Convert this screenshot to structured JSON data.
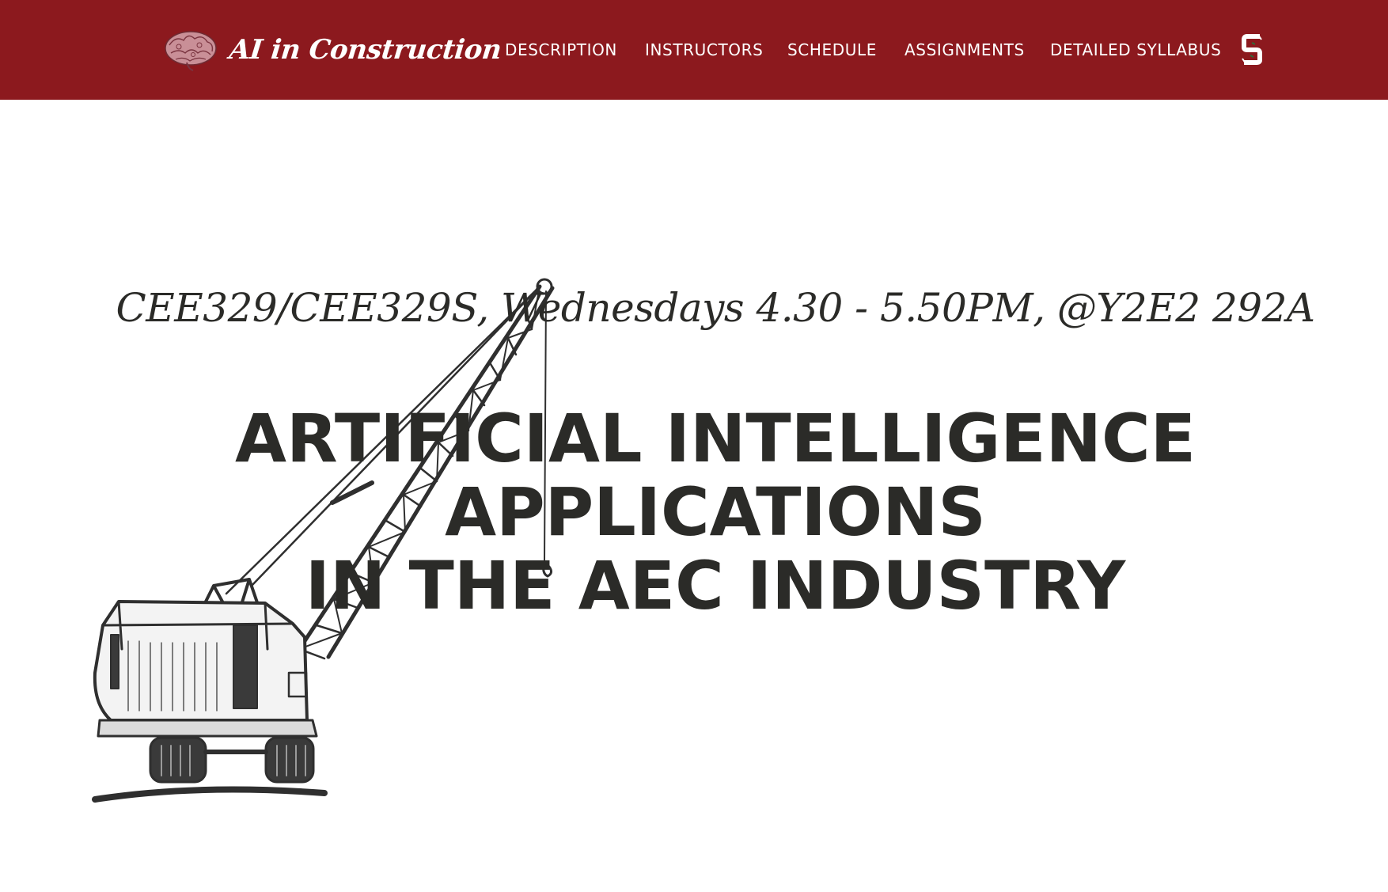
{
  "navbar": {
    "brand_text": "AI in Construction",
    "brand_logo_icon": "brain-icon",
    "links": [
      {
        "label": "DESCRIPTION"
      },
      {
        "label": "INSTRUCTORS"
      },
      {
        "label": "SCHEDULE"
      },
      {
        "label": "ASSIGNMENTS"
      },
      {
        "label": "DETAILED SYLLABUS"
      }
    ],
    "stanford_logo_icon": "stanford-s-icon",
    "background_color": "#8c191e"
  },
  "hero": {
    "subtitle": "CEE329/CEE329S, Wednesdays 4.30 - 5.50PM, @Y2E2 292A",
    "title_lines": [
      "ARTIFICIAL INTELLIGENCE",
      "APPLICATIONS",
      "IN THE AEC INDUSTRY"
    ],
    "background_illustration": "crane-illustration",
    "text_color": "#2b2b28"
  }
}
